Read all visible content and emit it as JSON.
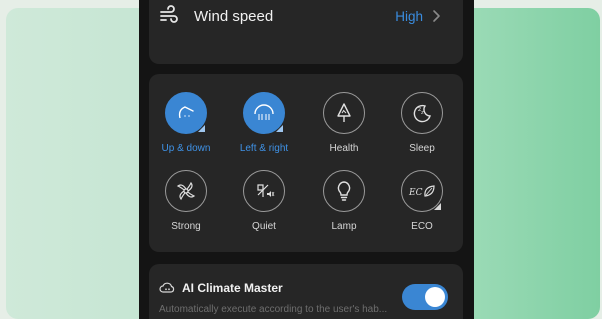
{
  "wind": {
    "label": "Wind speed",
    "value": "High",
    "icon": "wind-icon"
  },
  "modes": [
    {
      "label": "Up & down",
      "icon": "swing-up-down-icon",
      "active": true
    },
    {
      "label": "Left & right",
      "icon": "swing-left-right-icon",
      "active": true
    },
    {
      "label": "Health",
      "icon": "tree-icon",
      "active": false
    },
    {
      "label": "Sleep",
      "icon": "moon-zz-icon",
      "active": false
    },
    {
      "label": "Strong",
      "icon": "fan-strong-icon",
      "active": false
    },
    {
      "label": "Quiet",
      "icon": "fan-quiet-icon",
      "active": false
    },
    {
      "label": "Lamp",
      "icon": "lightbulb-icon",
      "active": false
    },
    {
      "label": "ECO",
      "icon": "eco-leaf-icon",
      "active": false
    }
  ],
  "ai": {
    "title": "AI Climate Master",
    "subtitle": "Automatically execute according to the user's hab...",
    "enabled": true
  },
  "colors": {
    "accent": "#3a86d3",
    "panel": "#262626",
    "background": "#141414"
  }
}
